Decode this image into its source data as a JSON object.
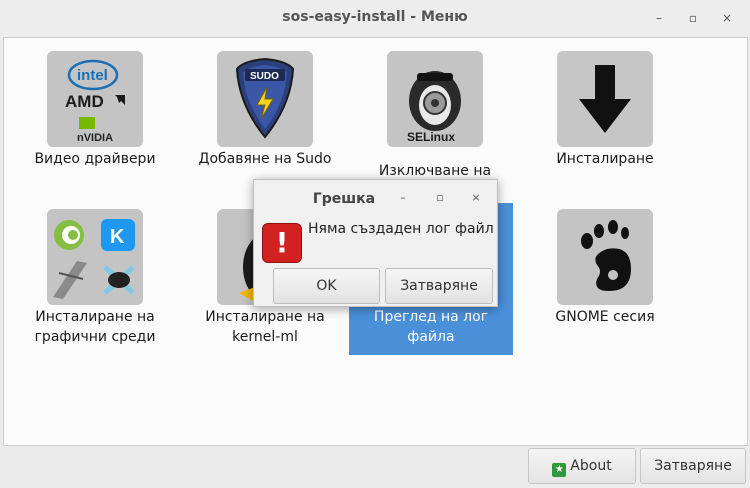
{
  "window": {
    "title": "sos-easy-install - Меню",
    "minimize": "–",
    "maximize": "▫",
    "close": "×"
  },
  "tiles": [
    {
      "label_lines": [
        "Видео драйвери"
      ],
      "icon": "gpu-vendors-icon"
    },
    {
      "label_lines": [
        "Добавяне на Sudo"
      ],
      "icon": "sudo-badge-icon"
    },
    {
      "label_lines": [
        "Изключване на",
        "SELinux"
      ],
      "icon": "selinux-penguin-icon"
    },
    {
      "label_lines": [
        "Инсталиране"
      ],
      "icon": "download-arrow-icon"
    },
    {
      "label_lines": [
        "Инсталиране на",
        "графични среди"
      ],
      "icon": "desktop-environments-icon"
    },
    {
      "label_lines": [
        "Инсталиране на",
        "kernel-ml"
      ],
      "icon": "tux-kernel-icon"
    },
    {
      "label_lines": [
        "Преглед на лог",
        "файла"
      ],
      "icon": "log-view-icon",
      "selected": true
    },
    {
      "label_lines": [
        "GNOME сесия"
      ],
      "icon": "gnome-foot-icon"
    }
  ],
  "icon_text": {
    "intel": "intel",
    "amd": "AMD",
    "nvidia": "nVIDIA",
    "sudo": "SUDO",
    "selinux": "SELinux"
  },
  "buttons": {
    "about": "About",
    "close": "Затваряне"
  },
  "dialog": {
    "title": "Грешка",
    "minimize": "–",
    "maximize": "▫",
    "close": "×",
    "message": "Няма създаден лог файл",
    "ok": "OK",
    "close_button": "Затваряне"
  },
  "colors": {
    "selection": "#4a90d9",
    "error": "#d32121",
    "about_icon": "#2e9a3b"
  }
}
